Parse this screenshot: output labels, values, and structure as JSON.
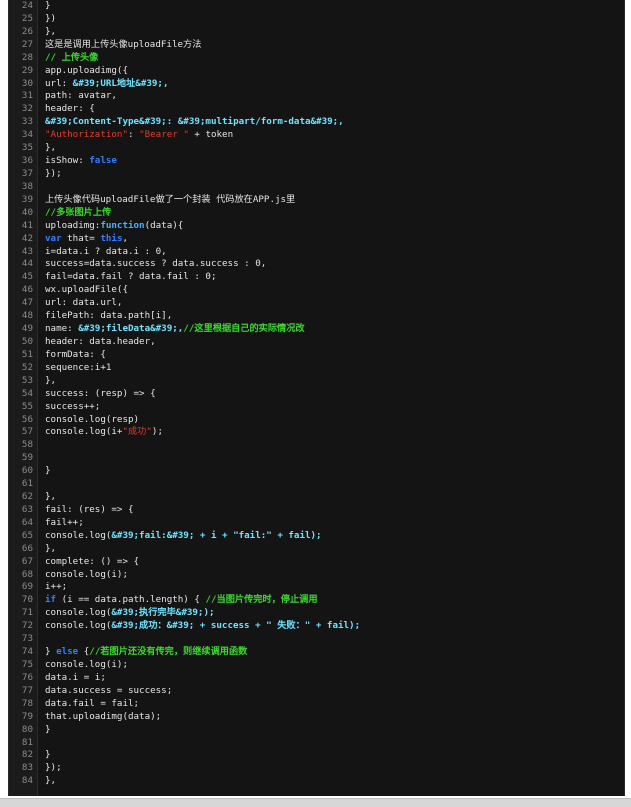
{
  "code_view": {
    "lines": [
      {
        "n": "24",
        "tokens": [
          {
            "t": "}",
            "c": "plain"
          }
        ]
      },
      {
        "n": "25",
        "tokens": [
          {
            "t": "})",
            "c": "plain"
          }
        ]
      },
      {
        "n": "26",
        "tokens": [
          {
            "t": "},",
            "c": "plain"
          }
        ]
      },
      {
        "n": "27",
        "tokens": [
          {
            "t": "这是是调用上传头像uploadFile方法",
            "c": "plain"
          }
        ]
      },
      {
        "n": "28",
        "tokens": [
          {
            "t": "// 上传头像",
            "c": "comment"
          }
        ]
      },
      {
        "n": "29",
        "tokens": [
          {
            "t": "app.uploadimg({",
            "c": "plain"
          }
        ]
      },
      {
        "n": "30",
        "tokens": [
          {
            "t": "url: ",
            "c": "plain"
          },
          {
            "t": "&#39;URL地址&#39;,",
            "c": "bright"
          }
        ]
      },
      {
        "n": "31",
        "tokens": [
          {
            "t": "path: avatar,",
            "c": "plain"
          }
        ]
      },
      {
        "n": "32",
        "tokens": [
          {
            "t": "header: {",
            "c": "plain"
          }
        ]
      },
      {
        "n": "33",
        "tokens": [
          {
            "t": "&#39;Content-Type&#39;: &#39;multipart/form-data&#39;,",
            "c": "bright"
          }
        ]
      },
      {
        "n": "34",
        "tokens": [
          {
            "t": "\"Authorization\"",
            "c": "string"
          },
          {
            "t": ": ",
            "c": "plain"
          },
          {
            "t": "\"Bearer \"",
            "c": "string"
          },
          {
            "t": " + token",
            "c": "plain"
          }
        ]
      },
      {
        "n": "35",
        "tokens": [
          {
            "t": "},",
            "c": "plain"
          }
        ]
      },
      {
        "n": "36",
        "tokens": [
          {
            "t": "isShow: ",
            "c": "plain"
          },
          {
            "t": "false",
            "c": "keyword"
          }
        ]
      },
      {
        "n": "37",
        "tokens": [
          {
            "t": "});",
            "c": "plain"
          }
        ]
      },
      {
        "n": "38",
        "tokens": []
      },
      {
        "n": "39",
        "tokens": [
          {
            "t": "上传头像代码uploadFile做了一个封装 代码放在APP.js里",
            "c": "plain"
          }
        ]
      },
      {
        "n": "40",
        "tokens": [
          {
            "t": "//多张图片上传",
            "c": "comment"
          }
        ]
      },
      {
        "n": "41",
        "tokens": [
          {
            "t": "uploadimg:",
            "c": "plain"
          },
          {
            "t": "function",
            "c": "func"
          },
          {
            "t": "(data){",
            "c": "plain"
          }
        ]
      },
      {
        "n": "42",
        "tokens": [
          {
            "t": "var",
            "c": "keyword"
          },
          {
            "t": " that= ",
            "c": "plain"
          },
          {
            "t": "this",
            "c": "keyword"
          },
          {
            "t": ",",
            "c": "plain"
          }
        ]
      },
      {
        "n": "43",
        "tokens": [
          {
            "t": "i=data.i ? data.i : 0,",
            "c": "plain"
          }
        ]
      },
      {
        "n": "44",
        "tokens": [
          {
            "t": "success=data.success ? data.success : 0,",
            "c": "plain"
          }
        ]
      },
      {
        "n": "45",
        "tokens": [
          {
            "t": "fail=data.fail ? data.fail : 0;",
            "c": "plain"
          }
        ]
      },
      {
        "n": "46",
        "tokens": [
          {
            "t": "wx.uploadFile({",
            "c": "plain"
          }
        ]
      },
      {
        "n": "47",
        "tokens": [
          {
            "t": "url: data.url,",
            "c": "plain"
          }
        ]
      },
      {
        "n": "48",
        "tokens": [
          {
            "t": "filePath: data.path[i],",
            "c": "plain"
          }
        ]
      },
      {
        "n": "49",
        "tokens": [
          {
            "t": "name: ",
            "c": "plain"
          },
          {
            "t": "&#39;fileData&#39;,",
            "c": "bright"
          },
          {
            "t": "//这里根据自己的实际情况改",
            "c": "comment"
          }
        ]
      },
      {
        "n": "50",
        "tokens": [
          {
            "t": "header: data.header,",
            "c": "plain"
          }
        ]
      },
      {
        "n": "51",
        "tokens": [
          {
            "t": "formData: {",
            "c": "plain"
          }
        ]
      },
      {
        "n": "52",
        "tokens": [
          {
            "t": "sequence:i+1",
            "c": "plain"
          }
        ]
      },
      {
        "n": "53",
        "tokens": [
          {
            "t": "},",
            "c": "plain"
          }
        ]
      },
      {
        "n": "54",
        "tokens": [
          {
            "t": "success: (resp) => {",
            "c": "plain"
          }
        ]
      },
      {
        "n": "55",
        "tokens": [
          {
            "t": "success++;",
            "c": "plain"
          }
        ]
      },
      {
        "n": "56",
        "tokens": [
          {
            "t": "console.log(resp)",
            "c": "plain"
          }
        ]
      },
      {
        "n": "57",
        "tokens": [
          {
            "t": "console.log(i+",
            "c": "plain"
          },
          {
            "t": "\"成功\"",
            "c": "string"
          },
          {
            "t": ");",
            "c": "plain"
          }
        ]
      },
      {
        "n": "58",
        "tokens": []
      },
      {
        "n": "59",
        "tokens": []
      },
      {
        "n": "60",
        "tokens": [
          {
            "t": "}",
            "c": "plain"
          }
        ]
      },
      {
        "n": "61",
        "tokens": []
      },
      {
        "n": "62",
        "tokens": [
          {
            "t": "},",
            "c": "plain"
          }
        ]
      },
      {
        "n": "63",
        "tokens": [
          {
            "t": "fail: (res) => {",
            "c": "plain"
          }
        ]
      },
      {
        "n": "64",
        "tokens": [
          {
            "t": "fail++;",
            "c": "plain"
          }
        ]
      },
      {
        "n": "65",
        "tokens": [
          {
            "t": "console.log(",
            "c": "plain"
          },
          {
            "t": "&#39;fail:&#39; + i + \"fail:\" + fail);",
            "c": "bright"
          }
        ]
      },
      {
        "n": "66",
        "tokens": [
          {
            "t": "},",
            "c": "plain"
          }
        ]
      },
      {
        "n": "67",
        "tokens": [
          {
            "t": "complete: () => {",
            "c": "plain"
          }
        ]
      },
      {
        "n": "68",
        "tokens": [
          {
            "t": "console.log(i);",
            "c": "plain"
          }
        ]
      },
      {
        "n": "69",
        "tokens": [
          {
            "t": "i++;",
            "c": "plain"
          }
        ]
      },
      {
        "n": "70",
        "tokens": [
          {
            "t": "if",
            "c": "keyword"
          },
          {
            "t": " (i == data.path.length) { ",
            "c": "plain"
          },
          {
            "t": "//当图片传完时，停止调用",
            "c": "comment"
          }
        ]
      },
      {
        "n": "71",
        "tokens": [
          {
            "t": "console.log(",
            "c": "plain"
          },
          {
            "t": "&#39;执行完毕&#39;);",
            "c": "bright"
          }
        ]
      },
      {
        "n": "72",
        "tokens": [
          {
            "t": "console.log(",
            "c": "plain"
          },
          {
            "t": "&#39;成功：&#39; + success + \" 失败：\" + fail);",
            "c": "bright"
          }
        ]
      },
      {
        "n": "73",
        "tokens": []
      },
      {
        "n": "74",
        "tokens": [
          {
            "t": "} ",
            "c": "plain"
          },
          {
            "t": "else",
            "c": "keyword"
          },
          {
            "t": " {",
            "c": "plain"
          },
          {
            "t": "//若图片还没有传完，则继续调用函数",
            "c": "comment"
          }
        ]
      },
      {
        "n": "75",
        "tokens": [
          {
            "t": "console.log(i);",
            "c": "plain"
          }
        ]
      },
      {
        "n": "76",
        "tokens": [
          {
            "t": "data.i = i;",
            "c": "plain"
          }
        ]
      },
      {
        "n": "77",
        "tokens": [
          {
            "t": "data.success = success;",
            "c": "plain"
          }
        ]
      },
      {
        "n": "78",
        "tokens": [
          {
            "t": "data.fail = fail;",
            "c": "plain"
          }
        ]
      },
      {
        "n": "79",
        "tokens": [
          {
            "t": "that.uploadimg(data);",
            "c": "plain"
          }
        ]
      },
      {
        "n": "80",
        "tokens": [
          {
            "t": "}",
            "c": "plain"
          }
        ]
      },
      {
        "n": "81",
        "tokens": []
      },
      {
        "n": "82",
        "tokens": [
          {
            "t": "}",
            "c": "plain"
          }
        ]
      },
      {
        "n": "83",
        "tokens": [
          {
            "t": "});",
            "c": "plain"
          }
        ]
      },
      {
        "n": "84",
        "tokens": [
          {
            "t": "},",
            "c": "plain"
          }
        ]
      }
    ]
  },
  "colors": {
    "background": "#141414",
    "gutter": "#1b1b1b",
    "plain": "#e6e6e6",
    "comment": "#39d92c",
    "keyword": "#2f7fff",
    "function": "#47b0ff",
    "string": "#e03c2e",
    "bright": "#6fe3ff"
  }
}
